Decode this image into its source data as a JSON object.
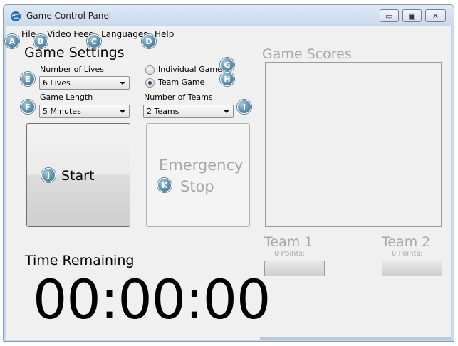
{
  "window": {
    "title": "Game Control Panel",
    "controls": {
      "minimize": "▭",
      "maximize": "▣",
      "close": "✕"
    }
  },
  "menu": {
    "file": "File",
    "video_feed": "Video Feed",
    "languages": "Languages",
    "help": "Help"
  },
  "badges": [
    "A",
    "B",
    "C",
    "D",
    "E",
    "F",
    "G",
    "H",
    "I",
    "J",
    "K"
  ],
  "settings": {
    "title": "Game Settings",
    "lives_label": "Number of Lives",
    "lives_value": "6 Lives",
    "length_label": "Game Length",
    "length_value": "5 Minutes",
    "mode_individual": "Individual Game",
    "mode_team": "Team Game",
    "selected_mode": "Team Game",
    "teams_label": "Number of Teams",
    "teams_value": "2 Teams"
  },
  "buttons": {
    "start": "Start",
    "emergency_line1": "Emergency",
    "emergency_line2": "Stop"
  },
  "timer": {
    "label": "Time Remaining",
    "value": "00:00:00"
  },
  "scores": {
    "title": "Game Scores",
    "teams": [
      {
        "name": "Team 1",
        "points": "0 Points:"
      },
      {
        "name": "Team 2",
        "points": "0 Points:"
      }
    ]
  },
  "colors": {
    "disabled_text": "#a0a0a0",
    "badge": "#5f8eab"
  }
}
